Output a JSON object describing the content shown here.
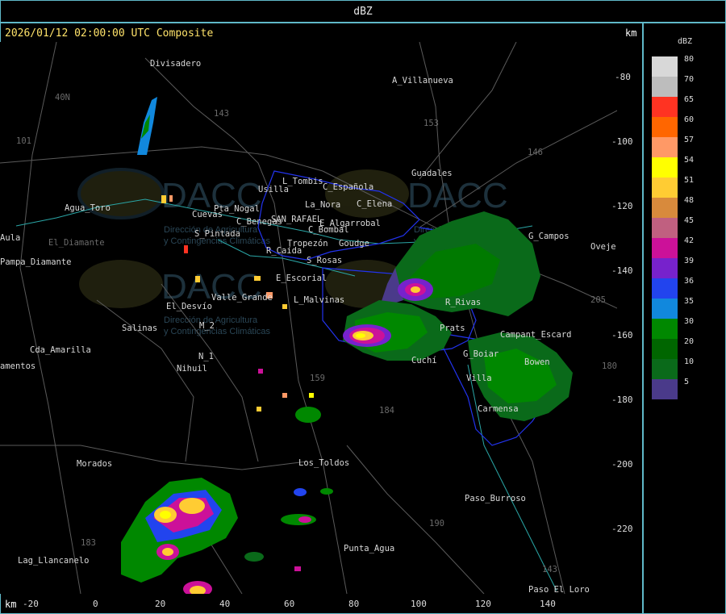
{
  "header": {
    "title": "dBZ"
  },
  "map": {
    "timestamp": "2026/01/12 02:00:00 UTC Composite",
    "unit_top": "km",
    "unit_bottom": "km",
    "x_ticks": [
      "-20",
      "0",
      "20",
      "40",
      "60",
      "80",
      "100",
      "120",
      "140"
    ],
    "y_ticks": [
      "-80",
      "-100",
      "-120",
      "-140",
      "-160",
      "-180",
      "-200",
      "-220"
    ],
    "places": [
      {
        "name": "Divisadero"
      },
      {
        "name": "A_Villanueva"
      },
      {
        "name": "40N"
      },
      {
        "name": "101"
      },
      {
        "name": "143"
      },
      {
        "name": "153"
      },
      {
        "name": "146"
      },
      {
        "name": "Guadales"
      },
      {
        "name": "L_Tombis"
      },
      {
        "name": "Usilla"
      },
      {
        "name": "C_Española"
      },
      {
        "name": "C_Elena"
      },
      {
        "name": "La_Nora"
      },
      {
        "name": "SAN_RAFAEL"
      },
      {
        "name": "C_Benegas"
      },
      {
        "name": "E_Algarrobal"
      },
      {
        "name": "C_Bombal"
      },
      {
        "name": "Goudge"
      },
      {
        "name": "Tropezón"
      },
      {
        "name": "Agua_Toro"
      },
      {
        "name": "Cuevas"
      },
      {
        "name": "Pta_Nogal"
      },
      {
        "name": "S_Pintada"
      },
      {
        "name": "Aula"
      },
      {
        "name": "Pampa_Diamante"
      },
      {
        "name": "El_Diamante"
      },
      {
        "name": "R_Caída"
      },
      {
        "name": "S_Rosas"
      },
      {
        "name": "E_Escorial"
      },
      {
        "name": "Valle_Grande"
      },
      {
        "name": "L_Malvinas"
      },
      {
        "name": "El_Desvío"
      },
      {
        "name": "Salinas"
      },
      {
        "name": "M_2"
      },
      {
        "name": "N_1"
      },
      {
        "name": "Nihuil"
      },
      {
        "name": "Cda_Amarilla"
      },
      {
        "name": "amentos"
      },
      {
        "name": "Morados"
      },
      {
        "name": "Los_Toldos"
      },
      {
        "name": "Paso_Burroso"
      },
      {
        "name": "Punta_Agua"
      },
      {
        "name": "Lag_Llancanelo"
      },
      {
        "name": "Paso_El_Loro"
      },
      {
        "name": "Carmensa"
      },
      {
        "name": "G_Campos"
      },
      {
        "name": "Ovejer"
      },
      {
        "name": "G_Boiar"
      },
      {
        "name": "Bowen"
      },
      {
        "name": "Campant_Escard"
      },
      {
        "name": "Prats"
      },
      {
        "name": "R_Rivas"
      },
      {
        "name": "Cuchí"
      },
      {
        "name": "Villa"
      },
      {
        "name": "159"
      },
      {
        "name": "184"
      },
      {
        "name": "190"
      },
      {
        "name": "183"
      },
      {
        "name": "205"
      },
      {
        "name": "143"
      },
      {
        "name": "180"
      }
    ],
    "watermark": {
      "text": "DACC",
      "sub1": "Dirección de Agricultura",
      "sub2": "y Contingencias Climáticas"
    }
  },
  "legend": {
    "unit": "dBZ",
    "levels": [
      {
        "label": "80",
        "color": "#d8d8d8"
      },
      {
        "label": "70",
        "color": "#bdbdbd"
      },
      {
        "label": "65",
        "color": "#ff3322"
      },
      {
        "label": "60",
        "color": "#ff6600"
      },
      {
        "label": "57",
        "color": "#ff9966"
      },
      {
        "label": "54",
        "color": "#ffff00"
      },
      {
        "label": "51",
        "color": "#ffcc33"
      },
      {
        "label": "48",
        "color": "#d88a3c"
      },
      {
        "label": "45",
        "color": "#c06080"
      },
      {
        "label": "42",
        "color": "#cc1199"
      },
      {
        "label": "39",
        "color": "#7722cc"
      },
      {
        "label": "36",
        "color": "#2244ee"
      },
      {
        "label": "35",
        "color": "#1188dd"
      },
      {
        "label": "30",
        "color": "#008800"
      },
      {
        "label": "20",
        "color": "#006600"
      },
      {
        "label": "10",
        "color": "#0a6a1a"
      },
      {
        "label": "5",
        "color": "#4a3a8a"
      }
    ]
  }
}
